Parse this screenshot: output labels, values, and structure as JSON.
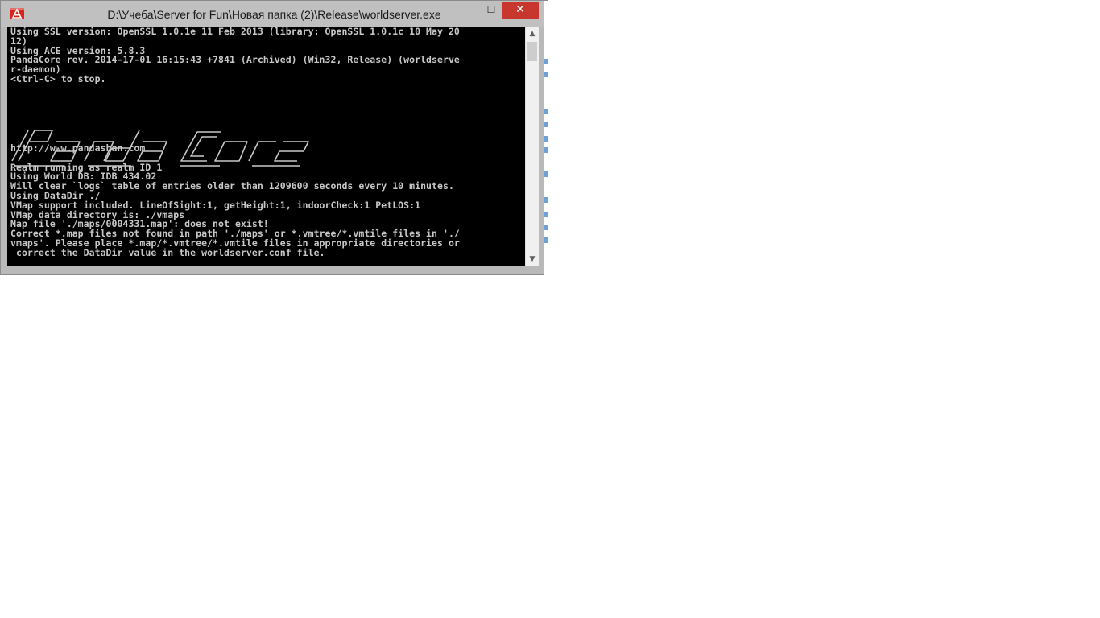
{
  "window": {
    "title": "D:\\Учеба\\Server for Fun\\Новая папка (2)\\Release\\worldserver.exe",
    "icon": "application-icon",
    "controls": {
      "minimize_glyph": "—",
      "maximize_glyph": "☐",
      "close_glyph": "✕"
    }
  },
  "console": {
    "background": "#000000",
    "text_color": "#c8c8c8",
    "lines_top": [
      "Using SSL version: OpenSSL 1.0.1e 11 Feb 2013 (library: OpenSSL 1.0.1c 10 May 20",
      "12)",
      "Using ACE version: 5.8.3",
      "PandaCore rev. 2014-17-01 16:15:43 +7841 (Archived) (Win32, Release) (worldserve",
      "r-daemon)",
      "<Ctrl-C> to stop."
    ],
    "logo_name": "pandacore-ascii-logo",
    "lines_bottom": [
      "http://www.pandashan.com",
      "",
      "Realm running as realm ID 1",
      "Using World DB: IDB 434.02",
      "Will clear `logs` table of entries older than 1209600 seconds every 10 minutes.",
      "Using DataDir ./",
      "VMap support included. LineOfSight:1, getHeight:1, indoorCheck:1 PetLOS:1",
      "VMap data directory is: ./vmaps",
      "Map file './maps/0004331.map': does not exist!",
      "Correct *.map files not found in path './maps' or *.vmtree/*.vmtile files in './",
      "vmaps'. Please place *.map/*.vmtree/*.vmtile files in appropriate directories or",
      " correct the DataDir value in the worldserver.conf file."
    ]
  },
  "scrollbar": {
    "up_glyph": "▲",
    "down_glyph": "▼"
  }
}
